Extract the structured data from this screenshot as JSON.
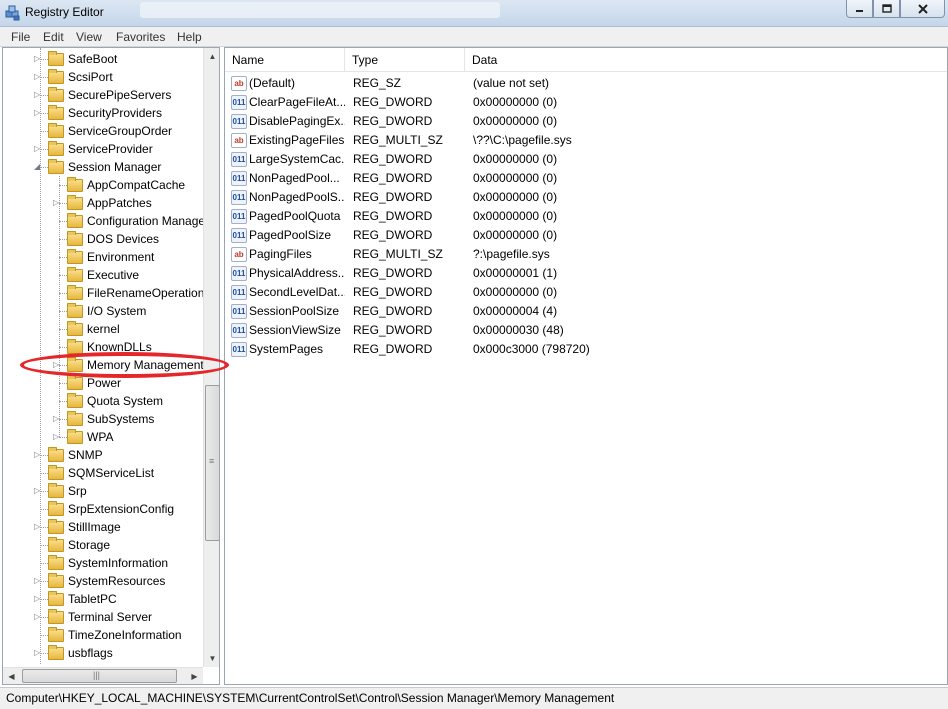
{
  "window": {
    "title": "Registry Editor",
    "icons": {
      "app": "registry-cube-icon",
      "minimize": "minimize-icon",
      "maximize": "restore-icon",
      "close": "close-icon"
    }
  },
  "menu": [
    "File",
    "Edit",
    "View",
    "Favorites",
    "Help"
  ],
  "tree": {
    "items": [
      {
        "label": "SafeBoot",
        "indent": 0,
        "expander": "collapsed"
      },
      {
        "label": "ScsiPort",
        "indent": 0,
        "expander": "collapsed"
      },
      {
        "label": "SecurePipeServers",
        "indent": 0,
        "expander": "collapsed"
      },
      {
        "label": "SecurityProviders",
        "indent": 0,
        "expander": "collapsed"
      },
      {
        "label": "ServiceGroupOrder",
        "indent": 0,
        "expander": "none"
      },
      {
        "label": "ServiceProvider",
        "indent": 0,
        "expander": "collapsed"
      },
      {
        "label": "Session Manager",
        "indent": 0,
        "expander": "expanded"
      },
      {
        "label": "AppCompatCache",
        "indent": 1,
        "expander": "none"
      },
      {
        "label": "AppPatches",
        "indent": 1,
        "expander": "collapsed"
      },
      {
        "label": "Configuration Manage",
        "indent": 1,
        "expander": "none"
      },
      {
        "label": "DOS Devices",
        "indent": 1,
        "expander": "none"
      },
      {
        "label": "Environment",
        "indent": 1,
        "expander": "none"
      },
      {
        "label": "Executive",
        "indent": 1,
        "expander": "none"
      },
      {
        "label": "FileRenameOperations",
        "indent": 1,
        "expander": "none"
      },
      {
        "label": "I/O System",
        "indent": 1,
        "expander": "none"
      },
      {
        "label": "kernel",
        "indent": 1,
        "expander": "none"
      },
      {
        "label": "KnownDLLs",
        "indent": 1,
        "expander": "none"
      },
      {
        "label": "Memory Management",
        "indent": 1,
        "expander": "collapsed",
        "selected": true
      },
      {
        "label": "Power",
        "indent": 1,
        "expander": "none"
      },
      {
        "label": "Quota System",
        "indent": 1,
        "expander": "none"
      },
      {
        "label": "SubSystems",
        "indent": 1,
        "expander": "collapsed"
      },
      {
        "label": "WPA",
        "indent": 1,
        "expander": "collapsed"
      },
      {
        "label": "SNMP",
        "indent": 0,
        "expander": "collapsed"
      },
      {
        "label": "SQMServiceList",
        "indent": 0,
        "expander": "none"
      },
      {
        "label": "Srp",
        "indent": 0,
        "expander": "collapsed"
      },
      {
        "label": "SrpExtensionConfig",
        "indent": 0,
        "expander": "none"
      },
      {
        "label": "StillImage",
        "indent": 0,
        "expander": "collapsed"
      },
      {
        "label": "Storage",
        "indent": 0,
        "expander": "none"
      },
      {
        "label": "SystemInformation",
        "indent": 0,
        "expander": "none"
      },
      {
        "label": "SystemResources",
        "indent": 0,
        "expander": "collapsed"
      },
      {
        "label": "TabletPC",
        "indent": 0,
        "expander": "collapsed"
      },
      {
        "label": "Terminal Server",
        "indent": 0,
        "expander": "collapsed"
      },
      {
        "label": "TimeZoneInformation",
        "indent": 0,
        "expander": "none"
      },
      {
        "label": "usbflags",
        "indent": 0,
        "expander": "collapsed"
      }
    ],
    "scrollbar": {
      "up": "scroll-up-arrow-icon",
      "down": "scroll-down-arrow-icon",
      "left": "scroll-left-arrow-icon",
      "right": "scroll-right-arrow-icon",
      "grip": "≡",
      "hgrip": "|||"
    }
  },
  "values": {
    "columns": [
      "Name",
      "Type",
      "Data"
    ],
    "rows": [
      {
        "name": "(Default)",
        "type": "REG_SZ",
        "data": "(value not set)",
        "icon": "string-value-icon"
      },
      {
        "name": "ClearPageFileAt...",
        "type": "REG_DWORD",
        "data": "0x00000000 (0)",
        "icon": "binary-value-icon"
      },
      {
        "name": "DisablePagingEx...",
        "type": "REG_DWORD",
        "data": "0x00000000 (0)",
        "icon": "binary-value-icon"
      },
      {
        "name": "ExistingPageFiles",
        "type": "REG_MULTI_SZ",
        "data": "\\??\\C:\\pagefile.sys",
        "icon": "string-value-icon"
      },
      {
        "name": "LargeSystemCac...",
        "type": "REG_DWORD",
        "data": "0x00000000 (0)",
        "icon": "binary-value-icon"
      },
      {
        "name": "NonPagedPool...",
        "type": "REG_DWORD",
        "data": "0x00000000 (0)",
        "icon": "binary-value-icon"
      },
      {
        "name": "NonPagedPoolS...",
        "type": "REG_DWORD",
        "data": "0x00000000 (0)",
        "icon": "binary-value-icon"
      },
      {
        "name": "PagedPoolQuota",
        "type": "REG_DWORD",
        "data": "0x00000000 (0)",
        "icon": "binary-value-icon"
      },
      {
        "name": "PagedPoolSize",
        "type": "REG_DWORD",
        "data": "0x00000000 (0)",
        "icon": "binary-value-icon"
      },
      {
        "name": "PagingFiles",
        "type": "REG_MULTI_SZ",
        "data": "?:\\pagefile.sys",
        "icon": "string-value-icon"
      },
      {
        "name": "PhysicalAddress...",
        "type": "REG_DWORD",
        "data": "0x00000001 (1)",
        "icon": "binary-value-icon"
      },
      {
        "name": "SecondLevelDat...",
        "type": "REG_DWORD",
        "data": "0x00000000 (0)",
        "icon": "binary-value-icon"
      },
      {
        "name": "SessionPoolSize",
        "type": "REG_DWORD",
        "data": "0x00000004 (4)",
        "icon": "binary-value-icon"
      },
      {
        "name": "SessionViewSize",
        "type": "REG_DWORD",
        "data": "0x00000030 (48)",
        "icon": "binary-value-icon"
      },
      {
        "name": "SystemPages",
        "type": "REG_DWORD",
        "data": "0x000c3000 (798720)",
        "icon": "binary-value-icon"
      }
    ],
    "icon_glyphs": {
      "string": "ab",
      "binary": "011"
    }
  },
  "status": {
    "path": "Computer\\HKEY_LOCAL_MACHINE\\SYSTEM\\CurrentControlSet\\Control\\Session Manager\\Memory Management"
  },
  "colors": {
    "annotation": "#e5262a",
    "window_chrome": "#c5d6ea"
  }
}
